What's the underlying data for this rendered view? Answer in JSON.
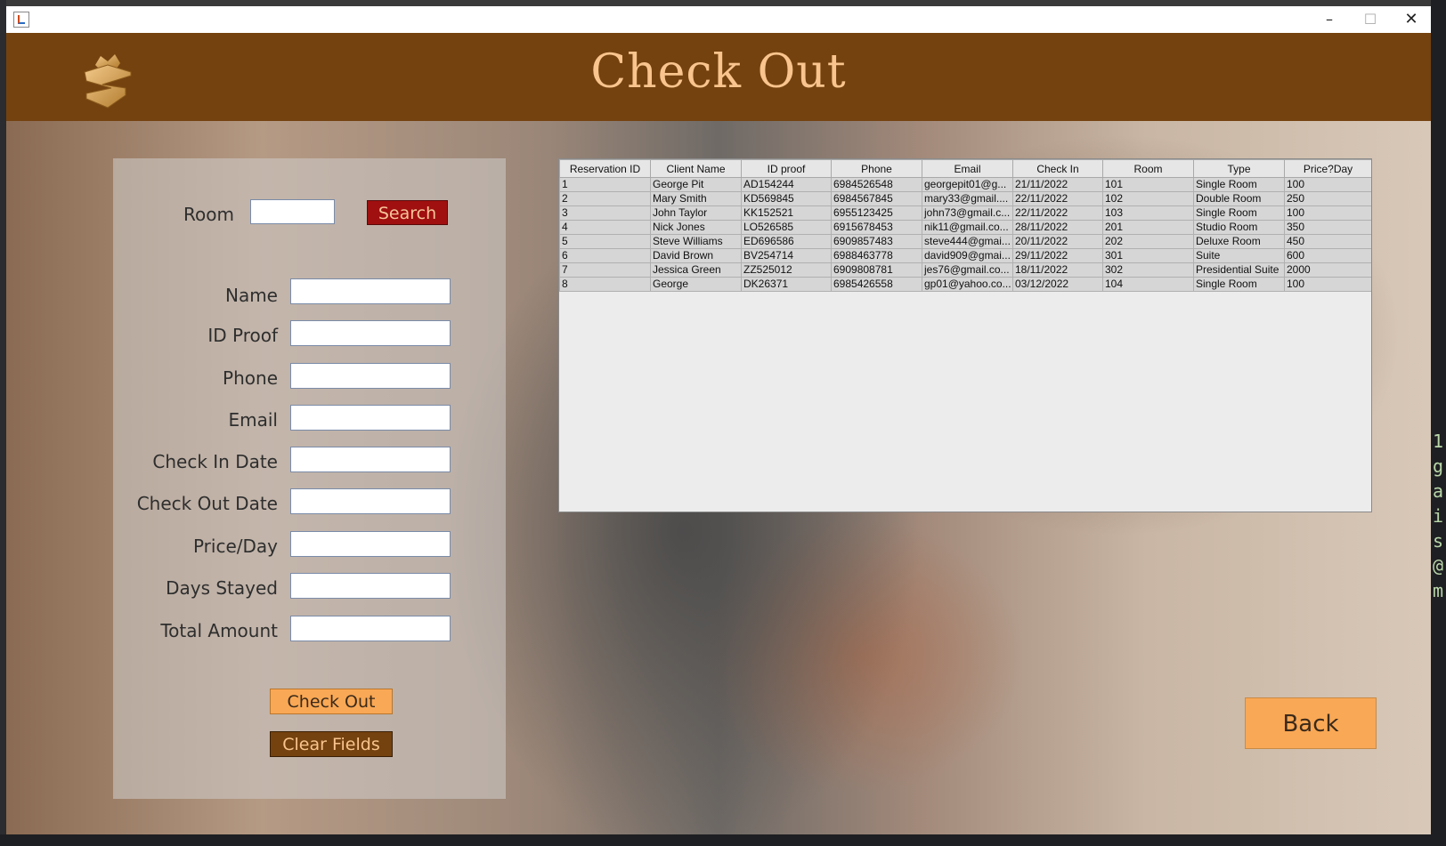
{
  "window": {
    "title": "",
    "controls": {
      "minimize": "–",
      "maximize": "☐",
      "close": "✕"
    }
  },
  "header": {
    "title": "Check Out",
    "logo": "crown-shield-logo"
  },
  "search": {
    "room_label": "Room",
    "room_value": "",
    "button_label": "Search"
  },
  "form": {
    "fields": [
      {
        "label": "Name",
        "value": ""
      },
      {
        "label": "ID Proof",
        "value": ""
      },
      {
        "label": "Phone",
        "value": ""
      },
      {
        "label": "Email",
        "value": ""
      },
      {
        "label": "Check In Date",
        "value": ""
      },
      {
        "label": "Check Out Date",
        "value": ""
      },
      {
        "label": "Price/Day",
        "value": ""
      },
      {
        "label": "Days Stayed",
        "value": ""
      },
      {
        "label": "Total Amount",
        "value": ""
      }
    ],
    "checkout_label": "Check Out",
    "clear_label": "Clear Fields"
  },
  "table": {
    "columns": [
      "Reservation ID",
      "Client Name",
      "ID proof",
      "Phone",
      "Email",
      "Check In",
      "Room",
      "Type",
      "Price?Day"
    ],
    "rows": [
      [
        "1",
        "George Pit",
        "AD154244",
        "6984526548",
        "georgepit01@g...",
        "21/11/2022",
        "101",
        "Single Room",
        "100"
      ],
      [
        "2",
        "Mary Smith",
        "KD569845",
        "6984567845",
        "mary33@gmail....",
        "22/11/2022",
        "102",
        "Double Room",
        "250"
      ],
      [
        "3",
        "John Taylor",
        "KK152521",
        "6955123425",
        "john73@gmail.c...",
        "22/11/2022",
        "103",
        "Single Room",
        "100"
      ],
      [
        "4",
        "Nick Jones",
        "LO526585",
        "6915678453",
        "nik11@gmail.co...",
        "28/11/2022",
        "201",
        "Studio Room",
        "350"
      ],
      [
        "5",
        "Steve Williams",
        "ED696586",
        "6909857483",
        "steve444@gmai...",
        "20/11/2022",
        "202",
        "Deluxe Room",
        "450"
      ],
      [
        "6",
        "David Brown",
        "BV254714",
        "6988463778",
        "david909@gmai...",
        "29/11/2022",
        "301",
        "Suite",
        "600"
      ],
      [
        "7",
        "Jessica Green",
        "ZZ525012",
        "6909808781",
        "jes76@gmail.co...",
        "18/11/2022",
        "302",
        "Presidential Suite",
        "2000"
      ],
      [
        "8",
        "George",
        "DK26371",
        "6985426558",
        "gp01@yahoo.co...",
        "03/12/2022",
        "104",
        "Single Room",
        "100"
      ]
    ]
  },
  "back_label": "Back",
  "colors": {
    "header_brown": "#74420f",
    "title_peach": "#f9c48d",
    "button_orange": "#f9a855",
    "search_red": "#a01010"
  }
}
